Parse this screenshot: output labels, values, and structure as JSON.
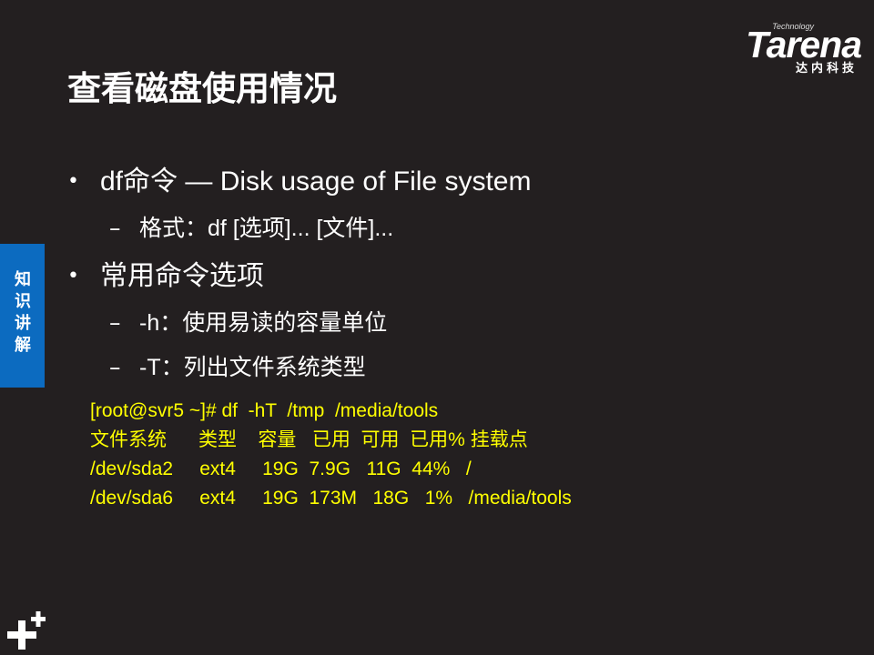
{
  "logo": {
    "tagline": "Technology",
    "brand": "Tarena",
    "cn": "达内科技"
  },
  "title": "查看磁盘使用情况",
  "side_tab": {
    "label": "知识讲解"
  },
  "bullets": [
    {
      "text": "df命令 — Disk usage of File system",
      "subs": [
        "格式：df  [选项]...  [文件]..."
      ]
    },
    {
      "text": "常用命令选项",
      "subs": [
        "-h：使用易读的容量单位",
        "-T：列出文件系统类型"
      ]
    }
  ],
  "terminal": [
    "[root@svr5 ~]# df  -hT  /tmp  /media/tools",
    "文件系统      类型    容量   已用  可用  已用% 挂载点",
    "/dev/sda2     ext4     19G  7.9G   11G  44%   /",
    "/dev/sda6     ext4     19G  173M   18G   1%   /media/tools"
  ],
  "colors": {
    "background": "#231f20",
    "side_tab": "#0c6bc0",
    "terminal_text": "#ffff00"
  }
}
